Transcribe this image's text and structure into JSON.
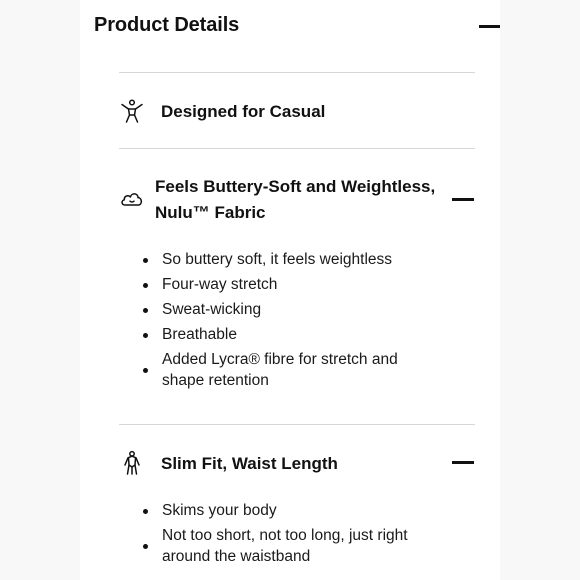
{
  "header": {
    "title": "Product Details"
  },
  "sections": [
    {
      "icon": "person-icon",
      "title": "Designed for Casual"
    },
    {
      "icon": "cloud-icon",
      "title_line1": "Feels Buttery-Soft and Weightless,",
      "title_line2": "Nulu™ Fabric",
      "bullets": [
        "So buttery soft, it feels weightless",
        "Four-way stretch",
        "Sweat-wicking",
        "Breathable",
        "Added Lycra® fibre for stretch and shape retention"
      ]
    },
    {
      "icon": "body-fit-icon",
      "title": "Slim Fit, Waist Length",
      "bullets": [
        "Skims your body",
        "Not too short, not too long, just right around the waistband"
      ]
    }
  ]
}
